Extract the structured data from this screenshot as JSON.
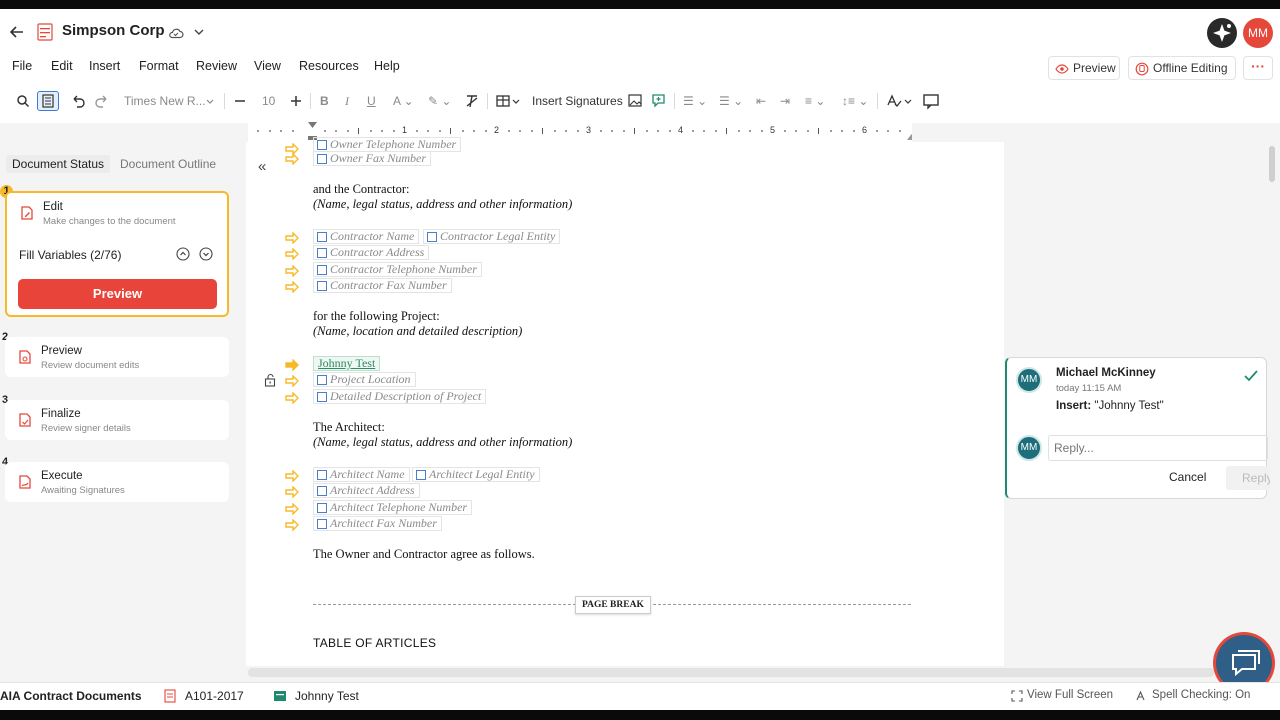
{
  "header": {
    "title": "Simpson Corp",
    "avatar_initials": "MM",
    "preview_label": "Preview",
    "offline_label": "Offline Editing",
    "more_label": "···"
  },
  "menu": [
    "File",
    "Edit",
    "Insert",
    "Format",
    "Review",
    "View",
    "Resources",
    "Help"
  ],
  "toolbar": {
    "font_name": "Times New R...",
    "font_size": "10",
    "insert_signatures": "Insert Signatures"
  },
  "ruler": [
    "1",
    "2",
    "3",
    "4",
    "5",
    "6"
  ],
  "left_panel": {
    "tabs": [
      "Document Status",
      "Document Outline"
    ],
    "steps": [
      {
        "num": "1",
        "title": "Edit",
        "subtitle": "Make changes to the document"
      },
      {
        "num": "2",
        "title": "Preview",
        "subtitle": "Review document edits"
      },
      {
        "num": "3",
        "title": "Finalize",
        "subtitle": "Review signer details"
      },
      {
        "num": "4",
        "title": "Execute",
        "subtitle": "Awaiting Signatures"
      }
    ],
    "fill_variables": "Fill Variables (2/76)",
    "preview_button": "Preview"
  },
  "document": {
    "owner_vars": [
      "Owner Telephone Number",
      "Owner Fax Number"
    ],
    "contractor_intro": "and the Contractor:",
    "contractor_hint": "(Name, legal status, address and other information)",
    "contractor_vars": [
      "Contractor Name",
      "Contractor Legal Entity",
      "Contractor Address",
      "Contractor Telephone Number",
      "Contractor Fax Number"
    ],
    "project_intro": "for the following Project:",
    "project_hint": "(Name, location and detailed description)",
    "project_filled": "Johnny Test",
    "project_vars": [
      "Project Location",
      "Detailed Description of Project"
    ],
    "architect_intro": "The Architect:",
    "architect_hint": "(Name, legal status, address and other information)",
    "architect_vars": [
      "Architect Name",
      "Architect Legal Entity",
      "Architect Address",
      "Architect Telephone Number",
      "Architect Fax Number"
    ],
    "agree_text": "The Owner and Contractor agree as follows.",
    "page_break": "PAGE BREAK",
    "table_of_articles": "TABLE OF ARTICLES"
  },
  "comment": {
    "author": "Michael McKinney",
    "initials": "MM",
    "time": "today 11:15 AM",
    "action": "Insert:",
    "content": "\"Johnny Test\"",
    "reply_placeholder": "Reply...",
    "cancel": "Cancel",
    "reply": "Reply"
  },
  "footer": {
    "brand": "AIA Contract Documents",
    "doc_code": "A101-2017",
    "project": "Johnny Test",
    "view_full": "View Full Screen",
    "spell": "Spell Checking: On"
  },
  "colors": {
    "accent_red": "#e8443a",
    "step_active": "#f7b928",
    "comment_green": "#1f8a70",
    "arrow_yellow": "#f7b928"
  }
}
